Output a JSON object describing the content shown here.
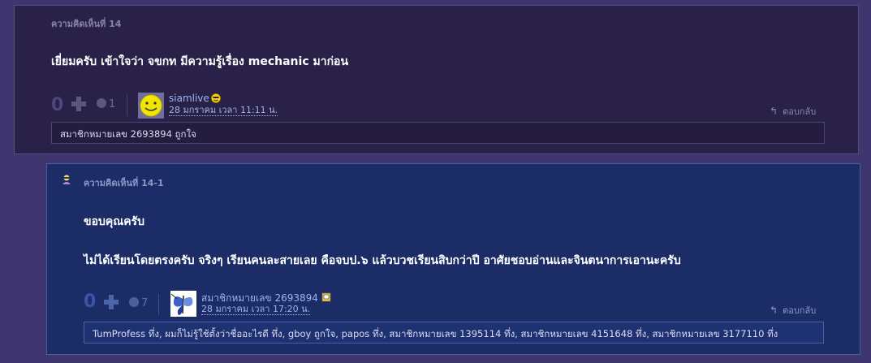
{
  "comment1": {
    "header": "ความคิดเห็นที่ 14",
    "body": "เยี่ยมครับ เข้าใจว่า จขกท มีความรู้เรื่อง mechanic มาก่อน",
    "votes": "0",
    "emotion_count": "1",
    "username": "siamlive",
    "date": "28 มกราคม เวลา 11:11 น.",
    "reply_label": "ตอบกลับ",
    "likes_text": "สมาชิกหมายเลข 2693894 ถูกใจ",
    "colors": {
      "card_bg": "#2a2148",
      "border": "#55507a"
    }
  },
  "comment2": {
    "header": "ความคิดเห็นที่ 14-1",
    "body_line1": "ขอบคุณครับ",
    "body_line2": "ไม่ได้เรียนโดยตรงครับ   จริงๆ เรียนคนละสายเลย คือจบป.๖  แล้วบวชเรียนสิบกว่าปี  อาศัยชอบอ่านและจินตนาการเอานะครับ",
    "votes": "0",
    "emotion_count": "7",
    "username": "สมาชิกหมายเลข 2693894",
    "date": "28 มกราคม เวลา 17:20 น.",
    "reply_label": "ตอบกลับ",
    "likes_text": "TumProfess ทึ่ง, ผมก็ไม่รู้ใช้ตั้งว่าชื่ออะไรดี ทึ่ง, gboy ถูกใจ, papos ทึ่ง, สมาชิกหมายเลข 1395114 ทึ่ง, สมาชิกหมายเลข 4151648 ทึ่ง, สมาชิกหมายเลข 3177110 ทึ่ง",
    "colors": {
      "card_bg": "#1b2c66",
      "border": "#4a5ba0"
    }
  },
  "icons": [
    "plus-icon",
    "emotion-icon",
    "avatar-smiley",
    "avatar-butterfly",
    "badge-icon",
    "reply-arrow-icon",
    "user-icon"
  ]
}
